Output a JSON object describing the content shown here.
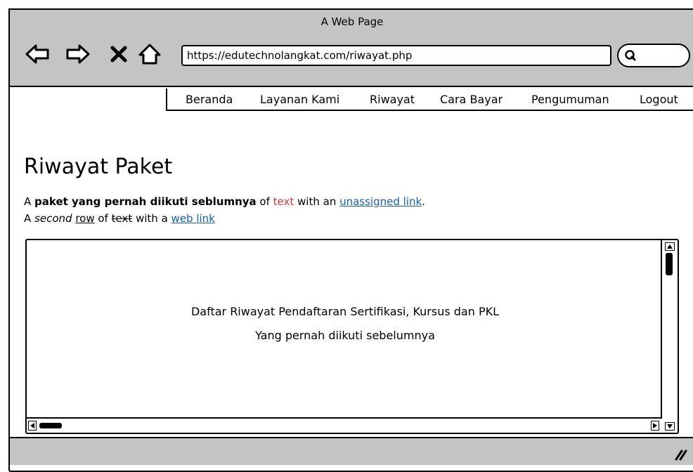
{
  "window": {
    "title": "A Web Page"
  },
  "toolbar": {
    "icons": [
      "back-arrow-icon",
      "forward-arrow-icon",
      "close-x-icon",
      "home-icon"
    ],
    "url": "https://edutechnolangkat.com/riwayat.php",
    "search_icon": "search-icon"
  },
  "menu": {
    "items": [
      {
        "label": "Beranda"
      },
      {
        "label": "Layanan Kami"
      },
      {
        "label": "Riwayat"
      },
      {
        "label": "Cara Bayar"
      },
      {
        "label": "Pengumuman"
      },
      {
        "label": "Logout"
      }
    ]
  },
  "main": {
    "title": "Riwayat Paket",
    "line1": {
      "p1": "A ",
      "bold": "paket yang pernah diikuti seblumnya",
      "p2": " of ",
      "red_text": "text",
      "p3": " with an ",
      "link": "unassigned link",
      "p4": "."
    },
    "line2": {
      "p1": "A ",
      "italic": "second",
      "p2": " ",
      "underlined": "row",
      "p3": " of ",
      "struck": "text",
      "p4": " with a ",
      "link": "web link"
    },
    "panel": {
      "line1": "Daftar Riwayat Pendaftaran Sertifikasi, Kursus dan PKL",
      "line2": "Yang pernah diikuti sebelumnya"
    }
  },
  "colors": {
    "chrome": "#c4c4c4",
    "link": "#1a5fa8",
    "red_text": "#d43a3a"
  }
}
